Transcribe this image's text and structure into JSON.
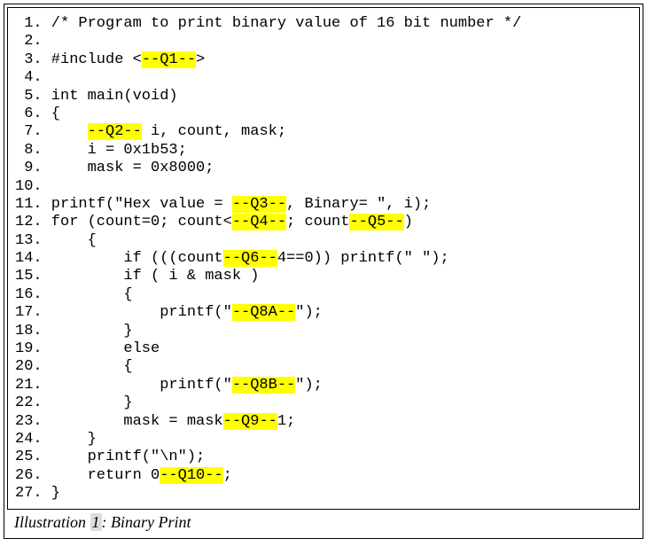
{
  "lines": {
    "l1_num": " 1",
    "l1_text": ". /* Program to print binary value of 16 bit number */",
    "l2_num": " 2",
    "l2_text": ".",
    "l3_num": " 3",
    "l3_a": ". #include <",
    "l3_hl": "--Q1--",
    "l3_b": ">",
    "l4_num": " 4",
    "l4_text": ".",
    "l5_num": " 5",
    "l5_text": ". int main(void)",
    "l6_num": " 6",
    "l6_text": ". {",
    "l7_num": " 7",
    "l7_a": ".     ",
    "l7_hl": "--Q2--",
    "l7_b": " i, count, mask;",
    "l8_num": " 8",
    "l8_text": ".     i = 0x1b53;",
    "l9_num": " 9",
    "l9_text": ".     mask = 0x8000;",
    "l10_num": "10",
    "l10_text": ".",
    "l11_num": "11",
    "l11_a": ". printf(\"Hex value = ",
    "l11_hl": "--Q3--",
    "l11_b": ", Binary= \", i);",
    "l12_num": "12",
    "l12_a": ". for (count=0; count<",
    "l12_hl1": "--Q4--",
    "l12_b": "; count",
    "l12_hl2": "--Q5--",
    "l12_c": ")",
    "l13_num": "13",
    "l13_text": ".     {",
    "l14_num": "14",
    "l14_a": ".         if (((count",
    "l14_hl": "--Q6--",
    "l14_b": "4==0)) printf(\" \");",
    "l15_num": "15",
    "l15_text": ".         if ( i & mask )",
    "l16_num": "16",
    "l16_text": ".         {",
    "l17_num": "17",
    "l17_a": ".             printf(\"",
    "l17_hl": "--Q8A--",
    "l17_b": "\");",
    "l18_num": "18",
    "l18_text": ".         }",
    "l19_num": "19",
    "l19_text": ".         else",
    "l20_num": "20",
    "l20_text": ".         {",
    "l21_num": "21",
    "l21_a": ".             printf(\"",
    "l21_hl": "--Q8B--",
    "l21_b": "\");",
    "l22_num": "22",
    "l22_text": ".         }",
    "l23_num": "23",
    "l23_a": ".         mask = mask",
    "l23_hl": "--Q9--",
    "l23_b": "1;",
    "l24_num": "24",
    "l24_text": ".     }",
    "l25_num": "25",
    "l25_text": ".     printf(\"\\n\");",
    "l26_num": "26",
    "l26_a": ".     return 0",
    "l26_hl": "--Q10--",
    "l26_b": ";",
    "l27_num": "27",
    "l27_text": ". }"
  },
  "caption": {
    "word_illustration": "Illustration ",
    "number": "1",
    "rest": ": Binary Print"
  }
}
